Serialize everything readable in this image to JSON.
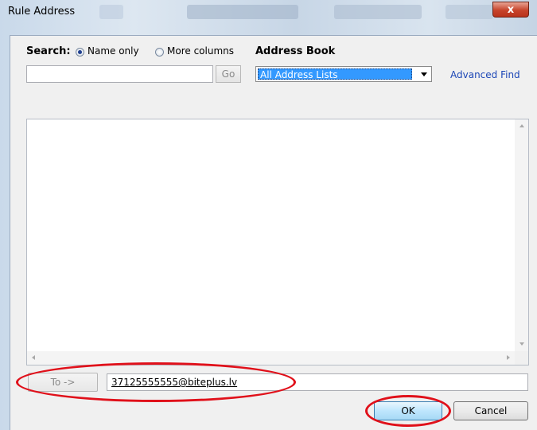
{
  "window": {
    "title": "Rule Address",
    "close_glyph": "x"
  },
  "search": {
    "label": "Search:",
    "option_name_only": "Name only",
    "option_more_columns": "More columns",
    "selected": "Name only",
    "input_value": "",
    "go_label": "Go"
  },
  "address_book": {
    "label": "Address Book",
    "selected_value": "All Address Lists",
    "advanced_find": "Advanced Find"
  },
  "results": {
    "items": []
  },
  "to": {
    "button_label": "To ->",
    "value": "37125555555@biteplus.lv"
  },
  "actions": {
    "ok_label": "OK",
    "cancel_label": "Cancel"
  },
  "annotations": {
    "color": "#e0101a"
  },
  "icons": [
    "close-icon",
    "dropdown-arrow-icon",
    "scroll-up-icon",
    "scroll-down-icon",
    "scroll-left-icon",
    "scroll-right-icon"
  ]
}
